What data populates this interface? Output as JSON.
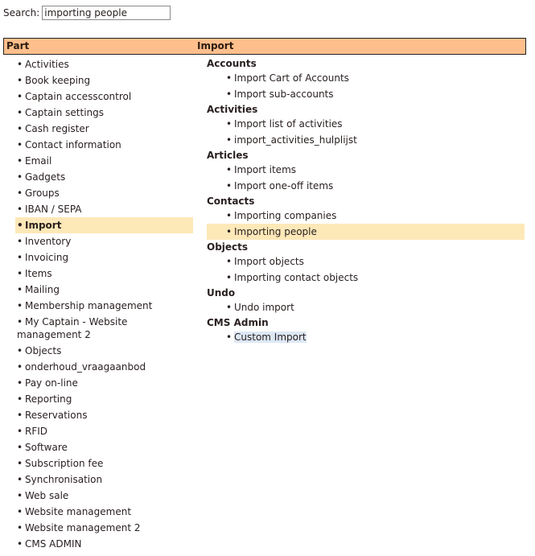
{
  "search": {
    "label": "Search:",
    "value": "importing people",
    "placeholder": ""
  },
  "header": {
    "col_part": "Part",
    "col_import": "Import",
    "color": "#ffbf8c"
  },
  "bullet": "•",
  "parts": [
    {
      "label": "Activities"
    },
    {
      "label": "Book keeping"
    },
    {
      "label": "Captain accesscontrol"
    },
    {
      "label": "Captain settings"
    },
    {
      "label": "Cash register"
    },
    {
      "label": "Contact information"
    },
    {
      "label": "Email"
    },
    {
      "label": "Gadgets"
    },
    {
      "label": "Groups"
    },
    {
      "label": "IBAN / SEPA"
    },
    {
      "label": "Import",
      "active": true
    },
    {
      "label": "Inventory"
    },
    {
      "label": "Invoicing"
    },
    {
      "label": "Items"
    },
    {
      "label": "Mailing"
    },
    {
      "label": "Membership management"
    },
    {
      "label": "My Captain - Website management 2"
    },
    {
      "label": "Objects"
    },
    {
      "label": "onderhoud_vraagaanbod"
    },
    {
      "label": "Pay on-line"
    },
    {
      "label": "Reporting"
    },
    {
      "label": "Reservations"
    },
    {
      "label": "RFID"
    },
    {
      "label": "Software"
    },
    {
      "label": "Subscription fee"
    },
    {
      "label": "Synchronisation"
    },
    {
      "label": "Web sale"
    },
    {
      "label": "Website management"
    },
    {
      "label": "Website management 2"
    },
    {
      "label": "CMS ADMIN"
    }
  ],
  "import_groups": [
    {
      "title": "Accounts",
      "items": [
        "Import Cart of Accounts",
        "Import sub-accounts"
      ]
    },
    {
      "title": "Activities",
      "items": [
        "Import list of activities",
        "import_activities_hulplijst"
      ]
    },
    {
      "title": "Articles",
      "items": [
        "Import items",
        "Import one-off items"
      ]
    },
    {
      "title": "Contacts",
      "items": [
        "Importing companies",
        "Importing people"
      ]
    },
    {
      "title": "Objects",
      "items": [
        "Import objects",
        "Importing contact objects"
      ]
    },
    {
      "title": "Undo",
      "items": [
        "Undo import"
      ]
    },
    {
      "title": "CMS Admin",
      "items": [
        "Custom Import"
      ]
    }
  ],
  "highlight": {
    "active_item": "Importing people",
    "selected_text_item": "Custom Import",
    "active_color": "#fde8b8"
  }
}
